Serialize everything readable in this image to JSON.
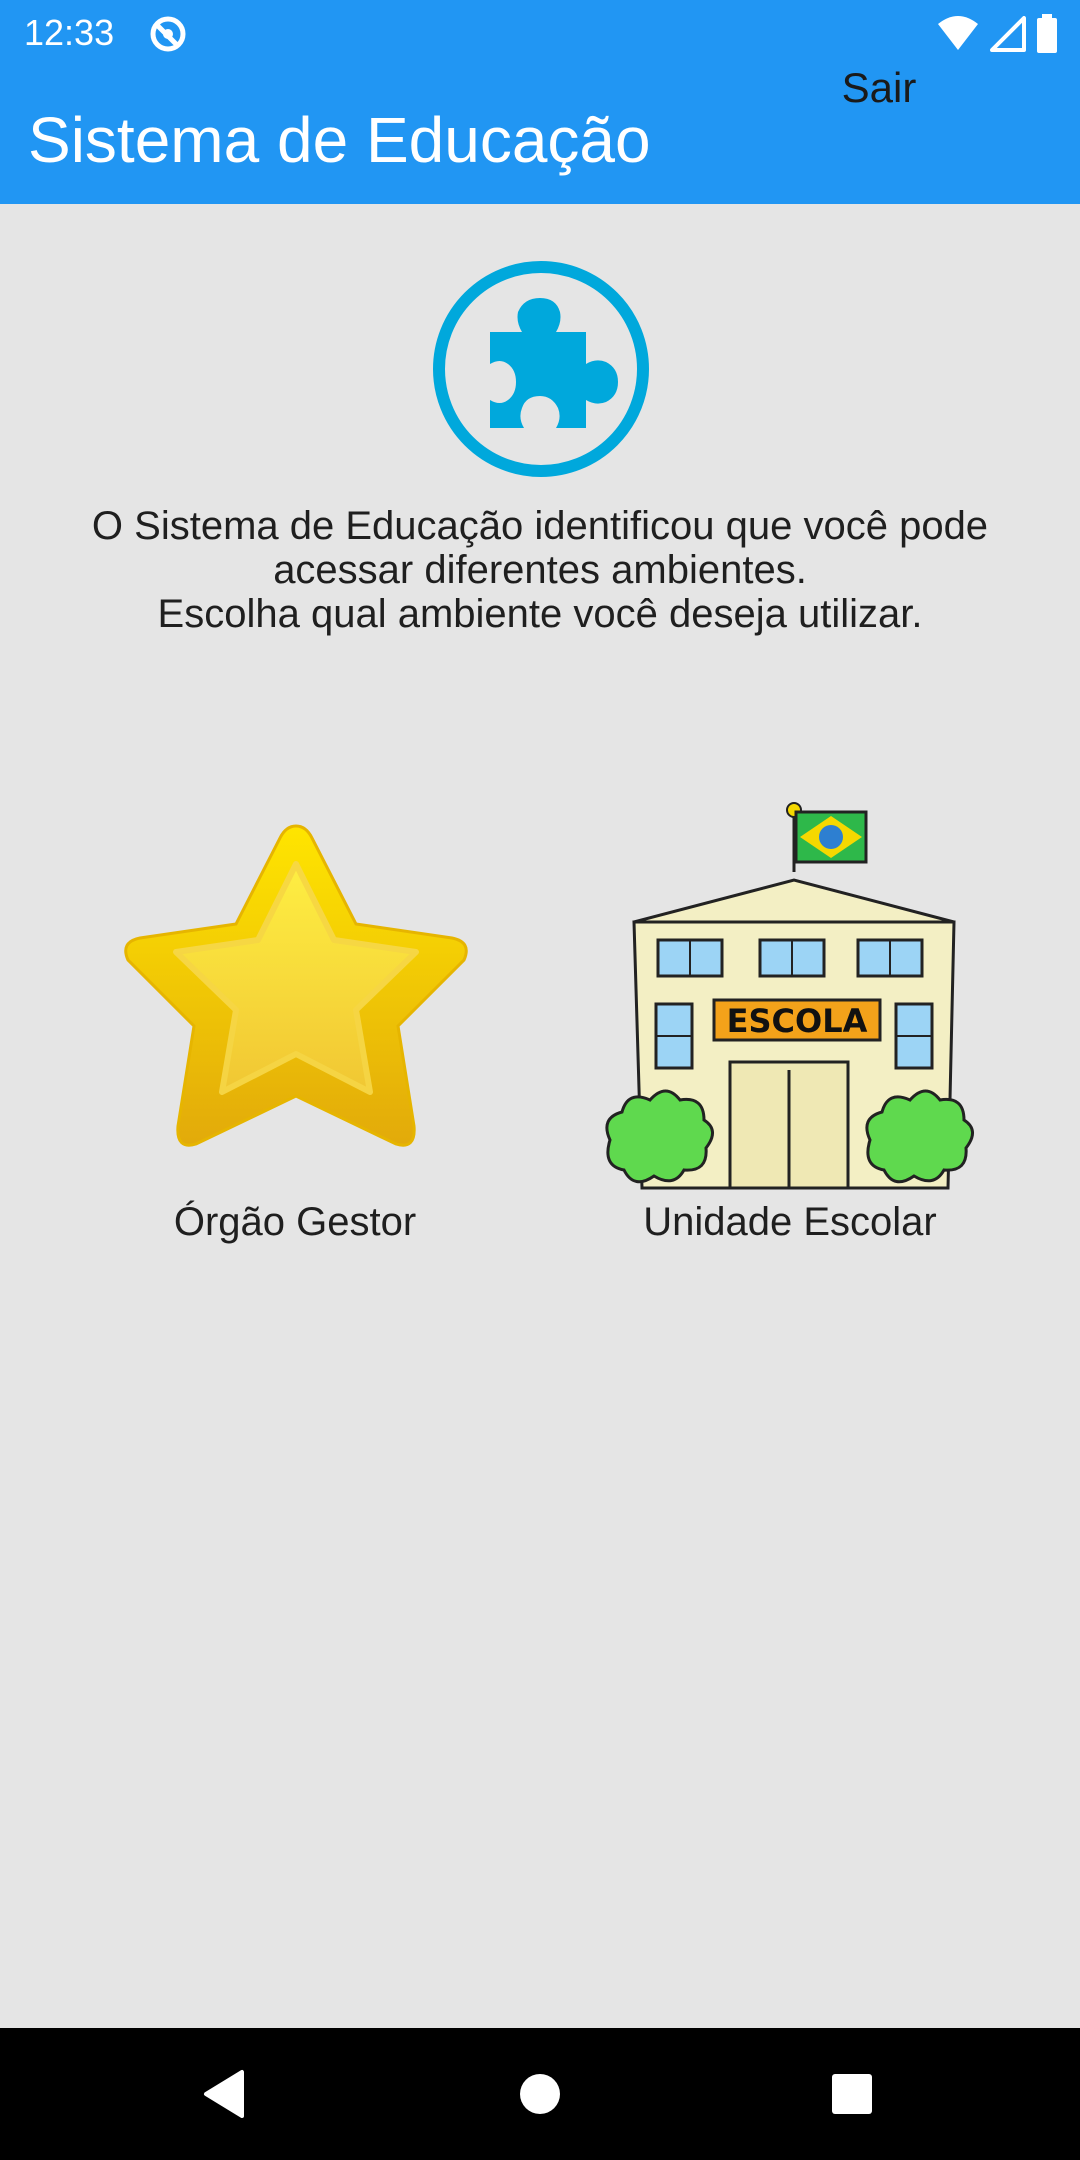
{
  "status_bar": {
    "time": "12:33",
    "icons": [
      "sync-app-icon",
      "wifi-icon",
      "cell-signal-icon",
      "battery-icon"
    ]
  },
  "app_bar": {
    "title": "Sistema de Educação",
    "logout_label": "Sair",
    "color": "#2196f3"
  },
  "main": {
    "hero_icon": "puzzle-piece-icon",
    "hero_color": "#00a8dc",
    "message_lines": [
      "O Sistema de Educação identificou que você pode",
      "acessar diferentes ambientes.",
      "Escolha qual ambiente você deseja utilizar."
    ],
    "options": [
      {
        "label": "Órgão Gestor",
        "icon": "star-icon"
      },
      {
        "label": "Unidade Escolar",
        "icon": "school-building-icon",
        "sign_text": "ESCOLA"
      }
    ]
  },
  "nav_bar": {
    "buttons": [
      "back-icon",
      "home-icon",
      "recents-icon"
    ]
  }
}
